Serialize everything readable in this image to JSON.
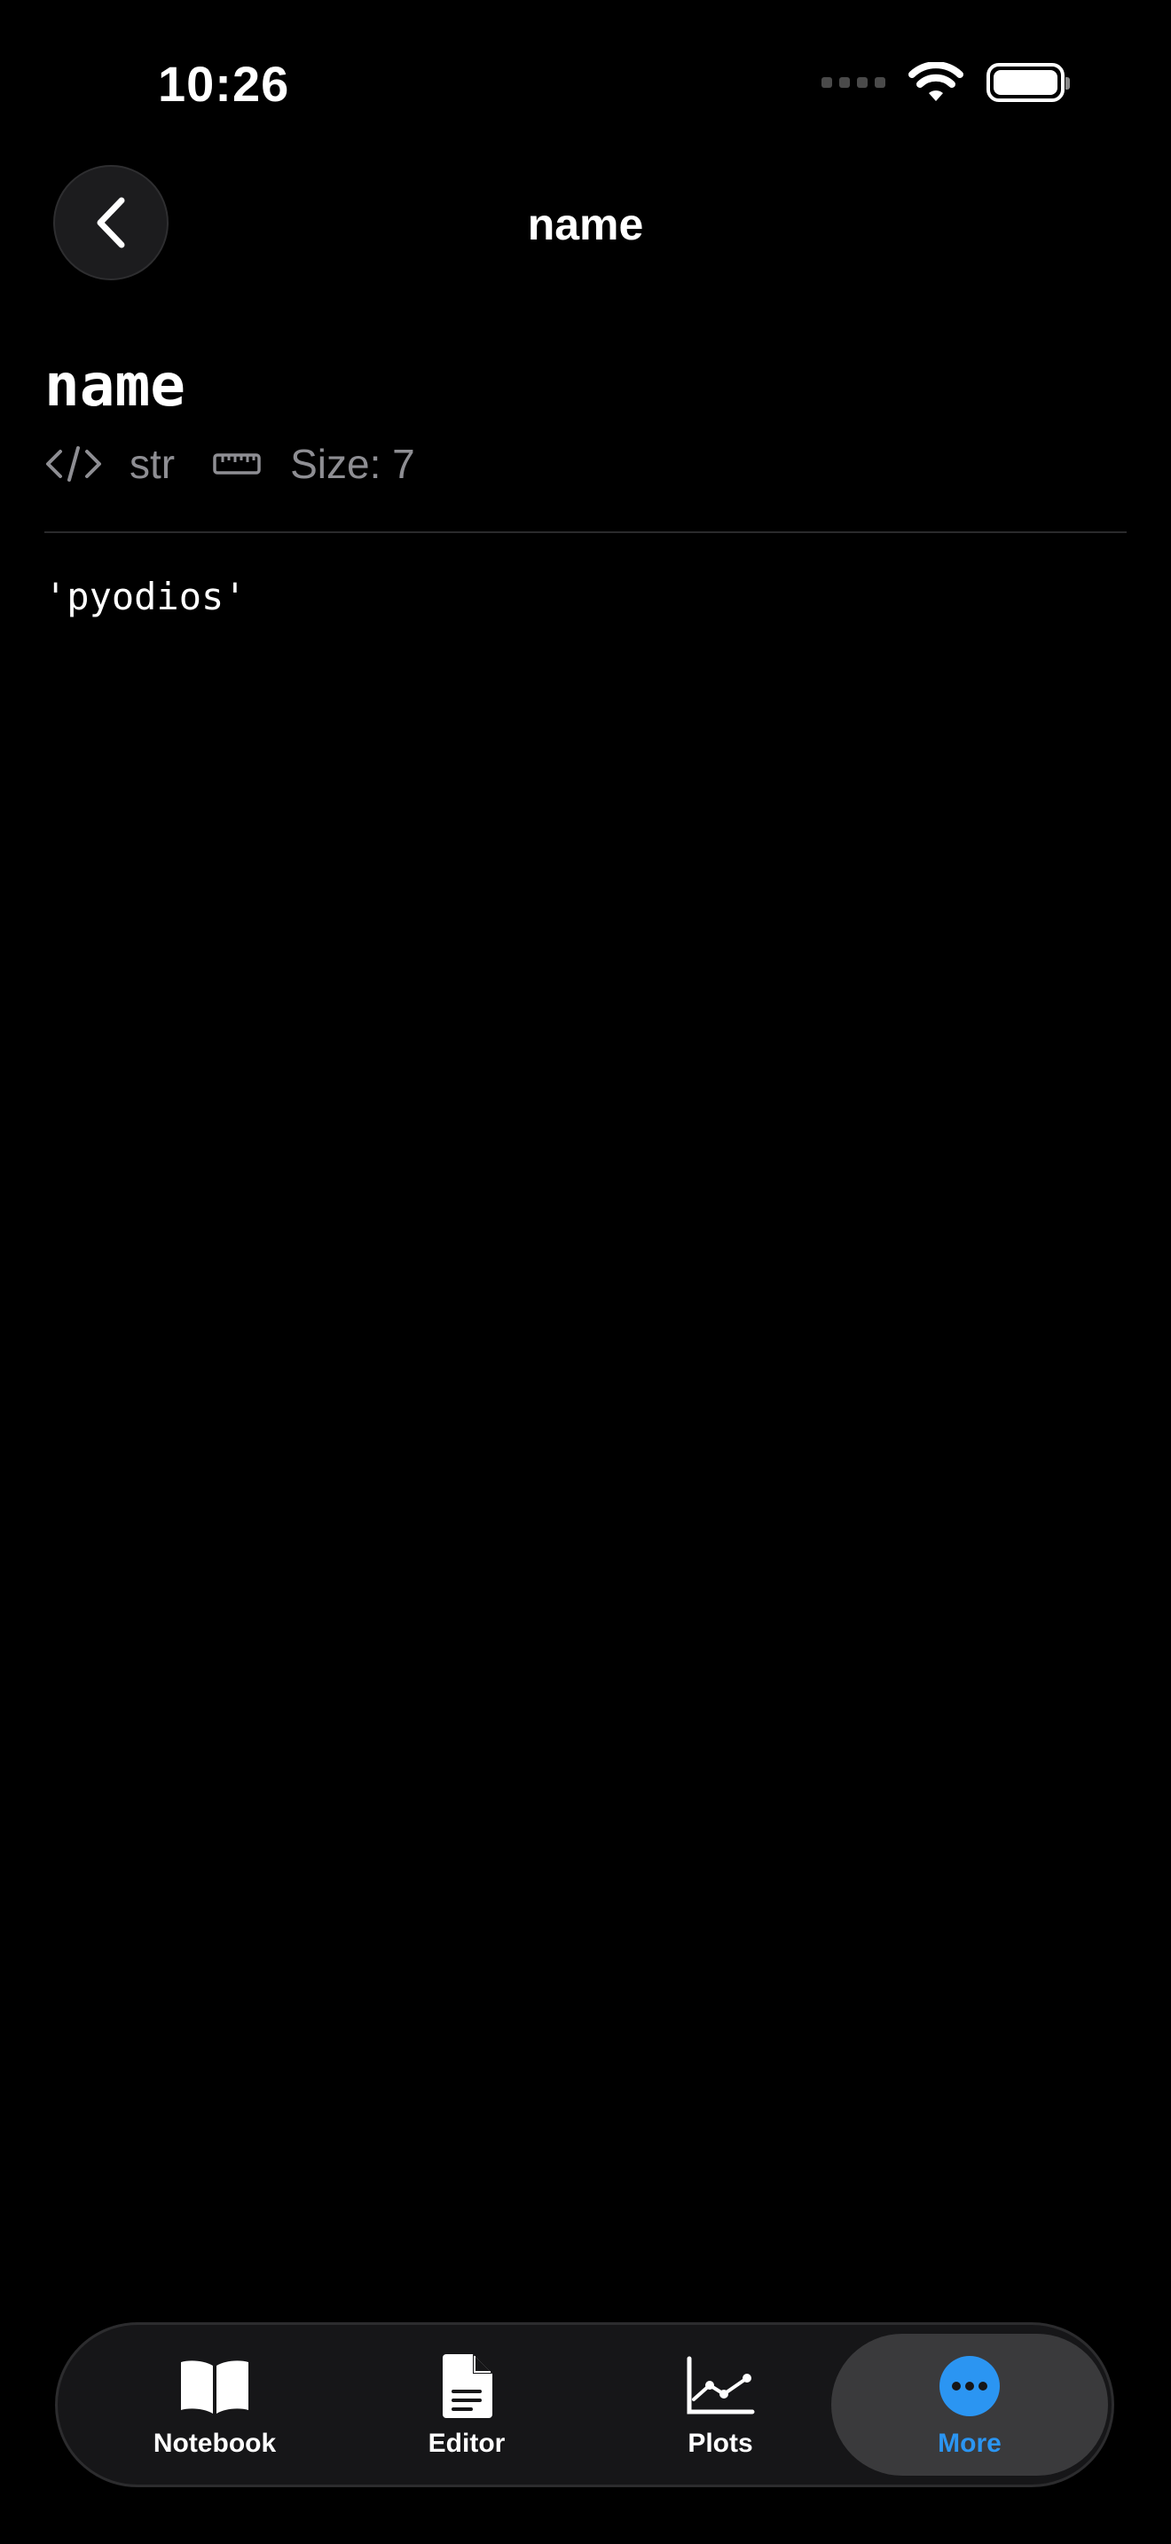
{
  "status_bar": {
    "time": "10:26"
  },
  "nav": {
    "title": "name",
    "back_icon": "chevron-left-icon"
  },
  "variable": {
    "name": "name",
    "type": "str",
    "size_label": "Size: 7",
    "value": "'pyodios'"
  },
  "tabs": [
    {
      "label": "Notebook",
      "icon": "book-icon",
      "active": false
    },
    {
      "label": "Editor",
      "icon": "document-icon",
      "active": false
    },
    {
      "label": "Plots",
      "icon": "line-chart-icon",
      "active": false
    },
    {
      "label": "More",
      "icon": "more-icon",
      "active": true
    }
  ],
  "colors": {
    "background": "#000000",
    "accent": "#2b95f2",
    "secondary_text": "#8e8e93"
  }
}
